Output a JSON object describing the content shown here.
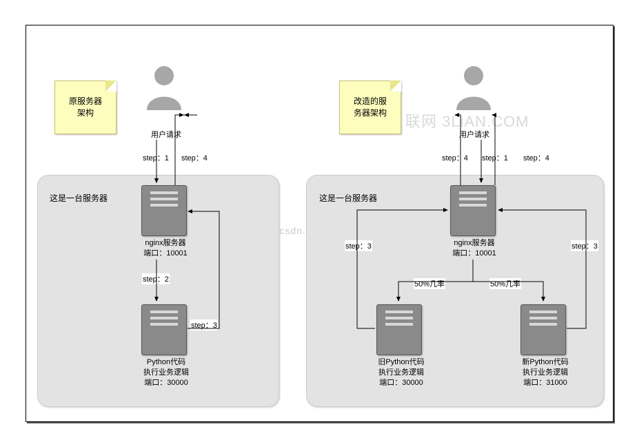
{
  "left": {
    "note": "原服务器\n架构",
    "user_label": "用户请求",
    "zone_title": "这是一台服务器",
    "nginx_caption": "nginx服务器\n端口：10001",
    "python_caption": "Python代码\n执行业务逻辑\n端口：30000",
    "steps": {
      "s1": "step：1",
      "s2": "step：2",
      "s3": "step：3",
      "s4": "step：4"
    }
  },
  "right": {
    "note": "改造的服\n务器架构",
    "user_label": "用户请求",
    "zone_title": "这是一台服务器",
    "nginx_caption": "nginx服务器\n端口：10001",
    "old_py_caption": "旧Python代码\n执行业务逻辑\n端口：30000",
    "new_py_caption": "新Python代码\n执行业务逻辑\n端口：31000",
    "steps": {
      "s1": "step：1",
      "s3a": "step：3",
      "s3b": "step：3",
      "s4a": "step：4",
      "s4b": "step：4"
    },
    "prob": {
      "left": "50%几率",
      "right": "50%几率"
    }
  },
  "watermarks": {
    "csdn": "http://blog.csdn.net/",
    "top": "联网 3LiAN.COM"
  }
}
